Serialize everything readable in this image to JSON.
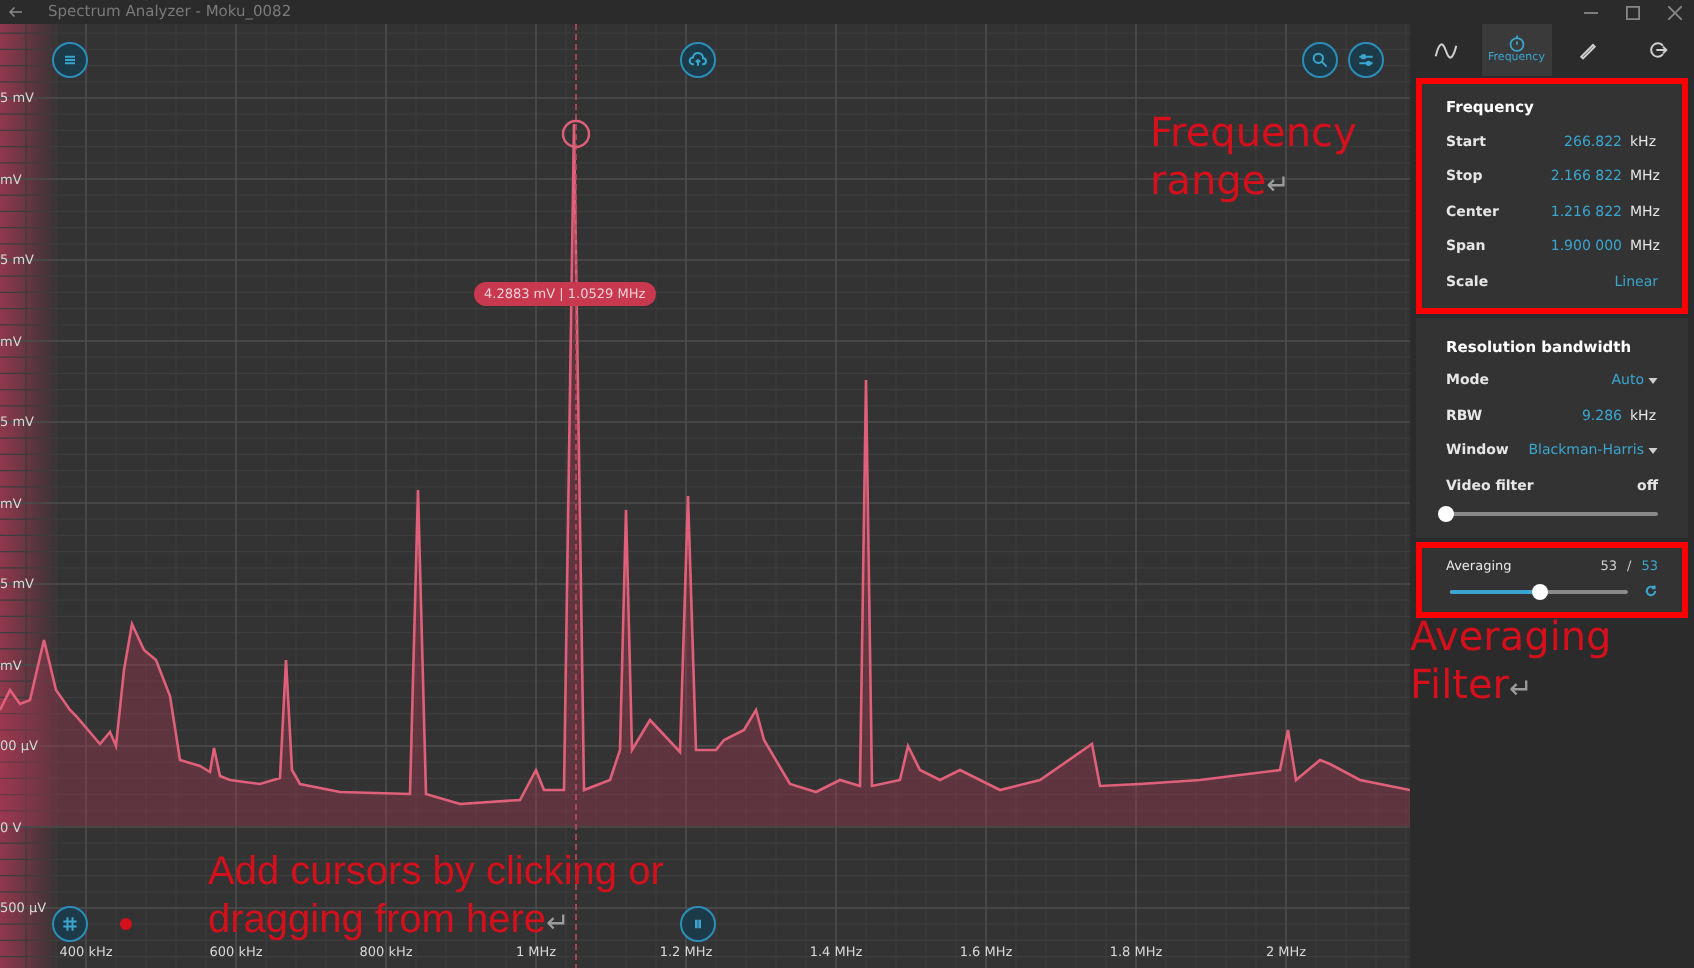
{
  "window": {
    "title": "Spectrum Analyzer - Moku_0082"
  },
  "plot": {
    "y_axis_labels": [
      "5 mV",
      "mV",
      "5 mV",
      "mV",
      "5 mV",
      "mV",
      "5 mV",
      "mV",
      "00 µV",
      "0 V",
      "500 µV"
    ],
    "x_axis_labels": [
      "400 kHz",
      "600 kHz",
      "800 kHz",
      "1 MHz",
      "1.2 MHz",
      "1.4 MHz",
      "1.6 MHz",
      "1.8 MHz",
      "2 MHz"
    ],
    "cursor_readout": "4.2883 mV | 1.0529 MHz"
  },
  "tabs": [
    {
      "kind": "trace",
      "selected": false
    },
    {
      "kind": "frequency",
      "label": "Frequency",
      "selected": true
    },
    {
      "kind": "measure",
      "selected": false
    },
    {
      "kind": "exit",
      "selected": false
    }
  ],
  "frequency_section": {
    "title": "Frequency",
    "highlighted": true,
    "rows": [
      {
        "kind": "value",
        "label": "Start",
        "value": "266.822",
        "unit": "kHz"
      },
      {
        "kind": "value",
        "label": "Stop",
        "value": "2.166 822",
        "unit": "MHz"
      },
      {
        "kind": "value",
        "label": "Center",
        "value": "1.216 822",
        "unit": "MHz"
      },
      {
        "kind": "value",
        "label": "Span",
        "value": "1.900 000",
        "unit": "MHz"
      },
      {
        "kind": "value",
        "label": "Scale",
        "value": "Linear"
      }
    ]
  },
  "rbw_section": {
    "title": "Resolution bandwidth",
    "highlighted": false,
    "rows": [
      {
        "kind": "dropdown",
        "label": "Mode",
        "value": "Auto"
      },
      {
        "kind": "value",
        "label": "RBW",
        "value": "9.286",
        "unit": "kHz"
      },
      {
        "kind": "dropdown",
        "label": "Window",
        "value": "Blackman-Harris"
      },
      {
        "kind": "slider",
        "label": "Video filter",
        "value": "off",
        "level": 0
      }
    ]
  },
  "averaging": {
    "label": "Averaging",
    "current": "53",
    "separator": "/",
    "target": "53",
    "level": 0.51,
    "highlighted": true
  },
  "annotations": [
    {
      "kind": "frequency",
      "text": "Frequency range",
      "mark": "↵"
    },
    {
      "kind": "averaging",
      "text": "Averaging Filter",
      "mark": "↵"
    },
    {
      "kind": "cursors",
      "text": "Add cursors by clicking or dragging from here",
      "mark": "↵"
    }
  ]
}
